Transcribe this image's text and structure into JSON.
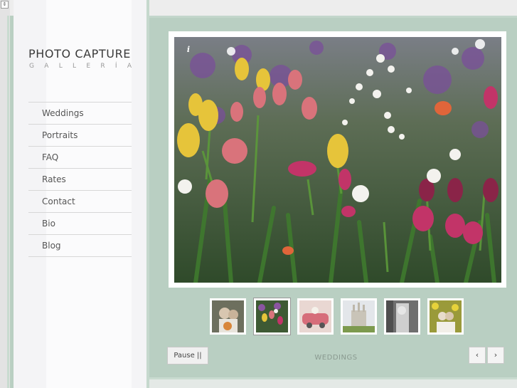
{
  "site": {
    "title": "PHOTO CAPTURE",
    "subtitle": "GALLERÍA"
  },
  "nav": {
    "items": [
      {
        "label": "Weddings"
      },
      {
        "label": "Portraits"
      },
      {
        "label": "FAQ"
      },
      {
        "label": "Rates"
      },
      {
        "label": "Contact"
      },
      {
        "label": "Bio"
      },
      {
        "label": "Blog"
      }
    ]
  },
  "slideshow": {
    "info_icon": "i",
    "pause_label": "Pause ||",
    "caption": "WEDDINGS",
    "prev_label": "‹",
    "next_label": "›",
    "active_thumb_index": 1,
    "thumbnails": [
      {
        "subject": "couple-portrait",
        "color": "#7f7b68"
      },
      {
        "subject": "tulips",
        "color": "#6b4e6a"
      },
      {
        "subject": "pink-car",
        "color": "#c97f89"
      },
      {
        "subject": "temple",
        "color": "#c9c7bf"
      },
      {
        "subject": "bride-bw",
        "color": "#8c8c8c"
      },
      {
        "subject": "couple-flowers",
        "color": "#a59a3e"
      }
    ]
  },
  "colors": {
    "background": "#b9cfc2",
    "sidebar": "#f4f4f6",
    "text": "#555555"
  }
}
